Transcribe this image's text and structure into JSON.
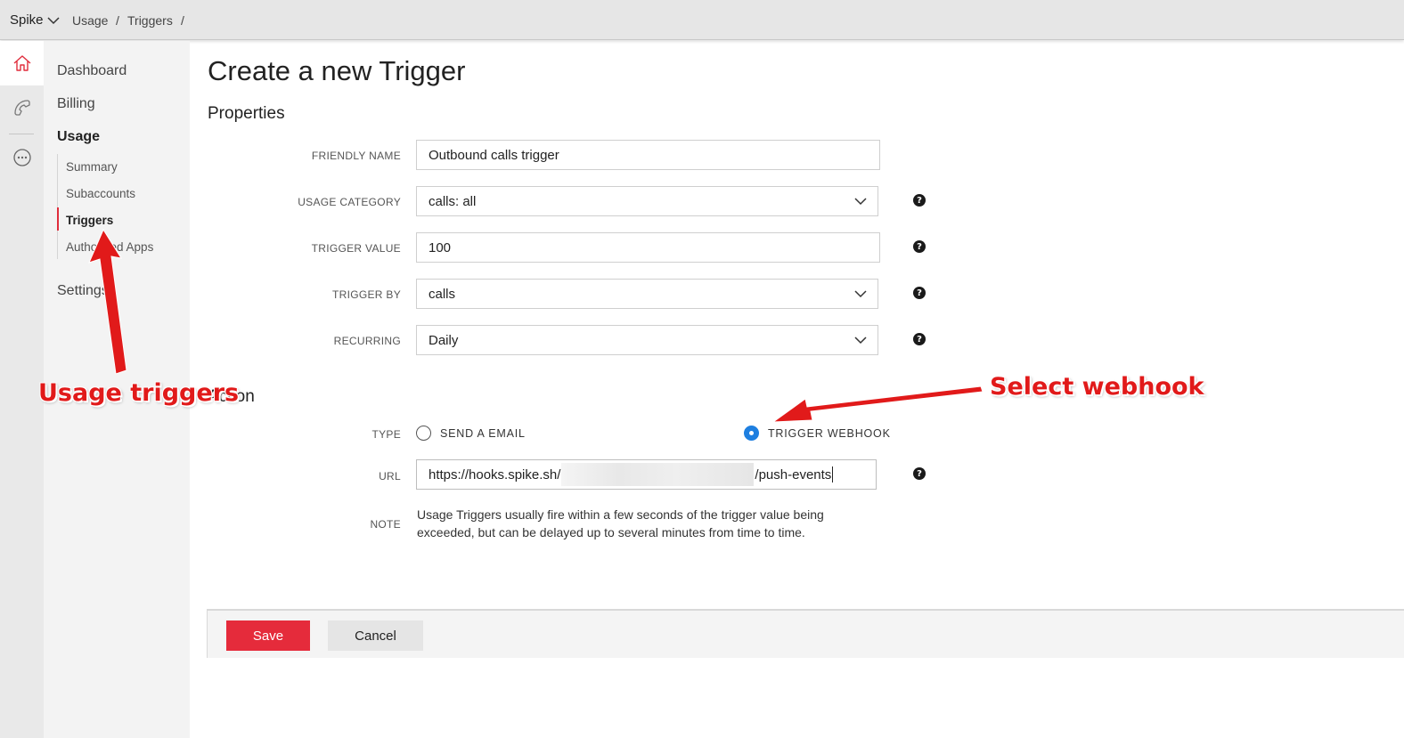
{
  "topbar": {
    "account": "Spike",
    "breadcrumb": [
      "Usage",
      "Triggers"
    ],
    "separator": "/"
  },
  "rail": {
    "icons": [
      "home-icon",
      "phone-icon",
      "more-icon"
    ],
    "accent_color": "#e02d3c"
  },
  "sidebar": {
    "items": [
      {
        "label": "Dashboard"
      },
      {
        "label": "Billing"
      },
      {
        "label": "Usage"
      },
      {
        "label": "Settings"
      }
    ],
    "subitems": [
      {
        "label": "Summary"
      },
      {
        "label": "Subaccounts"
      },
      {
        "label": "Triggers",
        "active": true
      },
      {
        "label": "Authorized Apps"
      }
    ]
  },
  "main": {
    "title": "Create a new Trigger",
    "properties_title": "Properties",
    "action_title": "Action",
    "fields": {
      "friendly_name": {
        "label": "FRIENDLY NAME",
        "value": "Outbound calls trigger"
      },
      "usage_category": {
        "label": "USAGE CATEGORY",
        "value": "calls: all"
      },
      "trigger_value": {
        "label": "TRIGGER VALUE",
        "value": "100"
      },
      "trigger_by": {
        "label": "TRIGGER BY",
        "value": "calls"
      },
      "recurring": {
        "label": "RECURRING",
        "value": "Daily"
      }
    },
    "help_glyph": "?",
    "type": {
      "label": "TYPE",
      "options": [
        {
          "label": "SEND A EMAIL",
          "selected": false
        },
        {
          "label": "TRIGGER WEBHOOK",
          "selected": true
        }
      ]
    },
    "url": {
      "label": "URL",
      "prefix": "https://hooks.spike.sh/",
      "suffix": "/push-events"
    },
    "note": {
      "label": "NOTE",
      "text": "Usage Triggers usually fire within a few seconds of the trigger value being exceeded, but can be delayed up to several minutes from time to time."
    }
  },
  "footer": {
    "save": "Save",
    "cancel": "Cancel",
    "save_color": "#e52b3b"
  },
  "annotations": {
    "left": "Usage triggers",
    "right": "Select webhook",
    "color": "#e11a1a"
  }
}
